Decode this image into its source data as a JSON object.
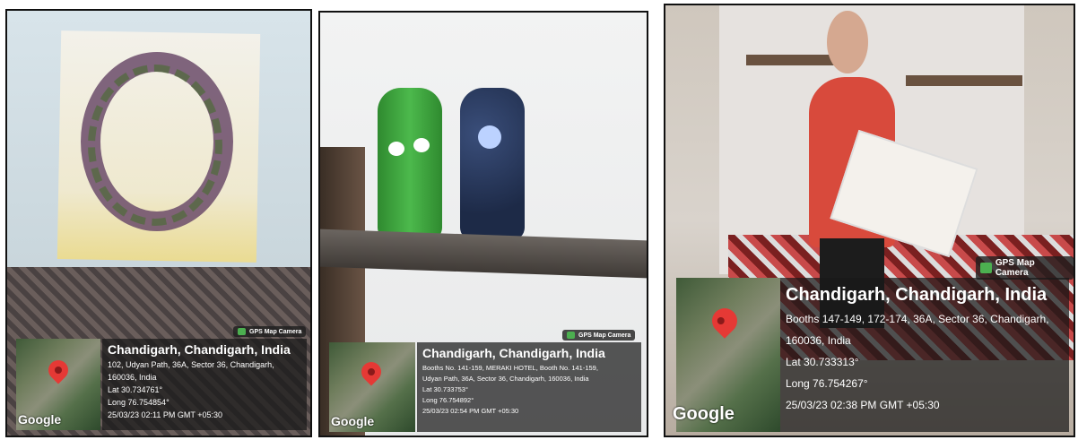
{
  "photos": [
    {
      "badge": "GPS Map Camera",
      "title": "Chandigarh, Chandigarh, India",
      "address_line1": "102, Udyan Path, 36A, Sector 36, Chandigarh,",
      "address_line2": "160036, India",
      "lat": "Lat 30.734761°",
      "long": "Long 76.754854°",
      "datetime": "25/03/23 02:11 PM GMT +05:30",
      "map_label": "Google"
    },
    {
      "badge": "GPS Map Camera",
      "title": "Chandigarh, Chandigarh, India",
      "address_line1": "Booths No. 141-159, MERAKI HOTEL, Booth No. 141-159,",
      "address_line2": "Udyan Path, 36A, Sector 36, Chandigarh, 160036, India",
      "lat": "Lat 30.733753°",
      "long": "Long 76.754892°",
      "datetime": "25/03/23 02:54 PM GMT +05:30",
      "map_label": "Google"
    },
    {
      "badge": "GPS Map Camera",
      "title": "Chandigarh, Chandigarh, India",
      "address_line1": "Booths 147-149, 172-174, 36A, Sector 36, Chandigarh,",
      "address_line2": "160036, India",
      "lat": "Lat 30.733313°",
      "long": "Long 76.754267°",
      "datetime": "25/03/23 02:38 PM GMT +05:30",
      "map_label": "Google"
    }
  ]
}
